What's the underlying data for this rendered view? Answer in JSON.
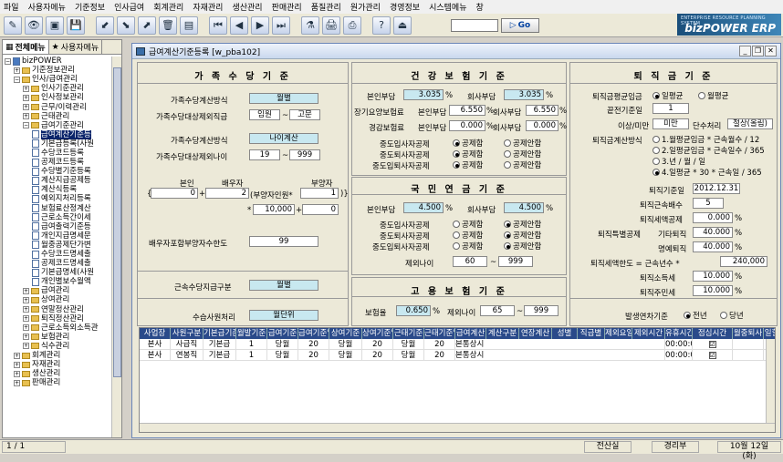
{
  "menu": [
    "파일",
    "사용자메뉴",
    "기준정보",
    "인사급여",
    "회계관리",
    "자재관리",
    "생산관리",
    "판매관리",
    "품질관리",
    "원가관리",
    "경영정보",
    "시스템메뉴",
    "창"
  ],
  "toolbar": {
    "go_label": "Go"
  },
  "logo": {
    "tagline": "ENTERPRISE RESOURCE PLANNING SYSTEM",
    "brand": "bizPOWER ERP"
  },
  "leftpane": {
    "tab1": "전체메뉴",
    "tab2": "사용자메뉴"
  },
  "tree": [
    {
      "l": 0,
      "t": "bizPOWER",
      "k": "root"
    },
    {
      "l": 1,
      "t": "기준정보관리",
      "k": "f+"
    },
    {
      "l": 1,
      "t": "인사/급여관리",
      "k": "f-"
    },
    {
      "l": 2,
      "t": "인사기준관리",
      "k": "f+"
    },
    {
      "l": 2,
      "t": "인사정보관리",
      "k": "f+"
    },
    {
      "l": 2,
      "t": "근무/이력관리",
      "k": "f+"
    },
    {
      "l": 2,
      "t": "근태관리",
      "k": "f+"
    },
    {
      "l": 2,
      "t": "급여기준관리",
      "k": "f-"
    },
    {
      "l": 3,
      "t": "급여계산기준등",
      "k": "d",
      "sel": true
    },
    {
      "l": 3,
      "t": "기본급등록(사원",
      "k": "d"
    },
    {
      "l": 3,
      "t": "수당코드등록",
      "k": "d"
    },
    {
      "l": 3,
      "t": "공제코드등록",
      "k": "d"
    },
    {
      "l": 3,
      "t": "수당별기준등록",
      "k": "d"
    },
    {
      "l": 3,
      "t": "계산지급공제등",
      "k": "d"
    },
    {
      "l": 3,
      "t": "계산식등록",
      "k": "d"
    },
    {
      "l": 3,
      "t": "예외지처리등록",
      "k": "d"
    },
    {
      "l": 3,
      "t": "보험료산정계산",
      "k": "d"
    },
    {
      "l": 3,
      "t": "근로소득간이세",
      "k": "d"
    },
    {
      "l": 3,
      "t": "급여출력기준등",
      "k": "d"
    },
    {
      "l": 3,
      "t": "개인지급명세문",
      "k": "d"
    },
    {
      "l": 3,
      "t": "월중공제단가변",
      "k": "d"
    },
    {
      "l": 3,
      "t": "수당코드명세출",
      "k": "d"
    },
    {
      "l": 3,
      "t": "공제코드명세출",
      "k": "d"
    },
    {
      "l": 3,
      "t": "기본급명세(사원",
      "k": "d"
    },
    {
      "l": 3,
      "t": "개인별보수월액",
      "k": "d"
    },
    {
      "l": 2,
      "t": "급여관리",
      "k": "f+"
    },
    {
      "l": 2,
      "t": "상여관리",
      "k": "f+"
    },
    {
      "l": 2,
      "t": "연말정산관리",
      "k": "f+"
    },
    {
      "l": 2,
      "t": "퇴직정산관리",
      "k": "f+"
    },
    {
      "l": 2,
      "t": "근로소득외소득관",
      "k": "f+"
    },
    {
      "l": 2,
      "t": "보험관리",
      "k": "f+"
    },
    {
      "l": 2,
      "t": "식수관리",
      "k": "f+"
    },
    {
      "l": 1,
      "t": "회계관리",
      "k": "f+"
    },
    {
      "l": 1,
      "t": "자재관리",
      "k": "f+"
    },
    {
      "l": 1,
      "t": "생산관리",
      "k": "f+"
    },
    {
      "l": 1,
      "t": "판매관리",
      "k": "f+"
    }
  ],
  "window": {
    "title": "급여계산기준등록 [w_pba102]"
  },
  "family": {
    "header": "가 족 수 당 기 준",
    "calc_method_label": "가족수당계산방식",
    "calc_method_value": "월별",
    "excl_job_label": "가족수당대상제외직급",
    "excl_job_from": "임원",
    "excl_job_to": "고문",
    "child_method_label": "가족수당계산방식",
    "child_method_value": "나이계산",
    "excl_age_label": "가족수당대상제외나이",
    "excl_age_from": "19",
    "excl_age_to": "999",
    "self_label": "본인",
    "spouse_label": "배우자",
    "dependent_label": "부양자",
    "formula_self": "0",
    "formula_spouse": "2",
    "formula_text": "(부양자인원*",
    "formula_dep": "1",
    "formula_times": "10,000",
    "formula_plus": "0",
    "limit_label": "배우자포함부양자수한도",
    "limit_value": "99",
    "service_pay_label": "근속수당지급구분",
    "service_pay_value": "월별",
    "collect_label": "수습사원처리",
    "collect_value": "월단위"
  },
  "health": {
    "header": "건 강 보 험 기 준",
    "self_label": "본인부담",
    "self_value": "3.035",
    "co_label": "회사부담",
    "co_value": "3.035",
    "ltc_label": "장기요양보험료",
    "ltc_self_label": "본인부담",
    "ltc_self_value": "6.550",
    "ltc_co_label": "회사부담",
    "ltc_co_value": "6.550",
    "mild_label": "경감보험료",
    "mild_self_label": "본인부담",
    "mild_self_value": "0.000",
    "mild_co_label": "회사부담",
    "mild_co_value": "0.000",
    "mid_join_label": "중도입사자공제",
    "mid_retire_label": "중도퇴사자공제",
    "mid_return_label": "중도입퇴사자공제",
    "opt_deduct": "공제함",
    "opt_no": "공제안함"
  },
  "pension": {
    "header": "국 민 연 금 기 준",
    "self_label": "본인부담",
    "self_value": "4.500",
    "co_label": "회사부담",
    "co_value": "4.500",
    "mid_join_label": "중도입사자공제",
    "mid_retire_label": "중도퇴사자공제",
    "mid_return_label": "중도입퇴사자공제",
    "opt_deduct": "공제함",
    "opt_no": "공제안함",
    "exempt_age_label": "제외나이",
    "exempt_age_from": "60",
    "exempt_age_to": "999"
  },
  "employ": {
    "header": "고 용 보 험 기 준",
    "rate_label": "보험율",
    "rate_value": "0.650",
    "exempt_age_label": "제외나이",
    "exempt_age_from": "65",
    "exempt_age_to": "999"
  },
  "retire": {
    "header": "퇴 직 금 기 준",
    "avg_label": "퇴직금평균임금",
    "avg_opt1": "일평균",
    "avg_opt2": "월평균",
    "month_label": "끝전기준일",
    "month_value": "1",
    "under_label": "이상/미만",
    "under_value": "미만",
    "round_label": "단수처리",
    "round_value": "절상(올림)",
    "calc_label": "퇴직금계산방식",
    "calc_opt1": "1.월평균임금 * 근속월수 / 12",
    "calc_opt2": "2.일평균임금 * 근속일수 / 365",
    "calc_opt3": "3.년 / 월 / 일",
    "calc_opt4": "4.일평균 * 30 * 근속일 / 365",
    "base_date_label": "퇴직기준일",
    "base_date_value": "2012.12.31",
    "svc_mult_label": "퇴직근속배수",
    "svc_mult_value": "5",
    "tax_rate_label": "퇴직세액공제",
    "tax_rate_value": "0.000",
    "special_label": "퇴직특별공제",
    "other_label": "기타퇴직",
    "other_value": "40.000",
    "honor_label": "명예퇴직",
    "honor_value": "40.000",
    "limit_label": "퇴직세액한도 = 근속년수 *",
    "limit_value": "240,000",
    "income_label": "퇴직소득세",
    "income_value": "10.000",
    "resident_label": "퇴직주민세",
    "resident_value": "10.000",
    "occur_label": "발생연차기준",
    "occur_opt1": "전년",
    "occur_opt2": "당년"
  },
  "grid": {
    "columns": [
      "사업장",
      "사원구분",
      "기본급기준",
      "월발기준",
      "급여기준",
      "급여기준일",
      "상여기준",
      "상여기준일",
      "근태기준",
      "근태기준일",
      "급여계산",
      "계산구분",
      "연장계산",
      "성별",
      "직급별",
      "제외요일",
      "제외시간",
      "유휴시간",
      "점심시간",
      "월중퇴사",
      "일할계"
    ],
    "rows": [
      [
        "본사",
        "사급직",
        "기본급",
        "1",
        "당월",
        "20",
        "당월",
        "20",
        "당월",
        "20",
        "본통상시",
        "",
        "",
        "",
        "",
        "",
        "",
        "00:00:000:00",
        "☑",
        ""
      ],
      [
        "본사",
        "연봉직",
        "기본급",
        "1",
        "당월",
        "20",
        "당월",
        "20",
        "당월",
        "20",
        "본통상시",
        "",
        "",
        "",
        "",
        "",
        "",
        "00:00:000:00",
        "☑",
        ""
      ]
    ]
  },
  "status": {
    "page": "1 / 1",
    "dept": "전산실",
    "user": "경리부",
    "date": "10월 12일 (화)"
  }
}
